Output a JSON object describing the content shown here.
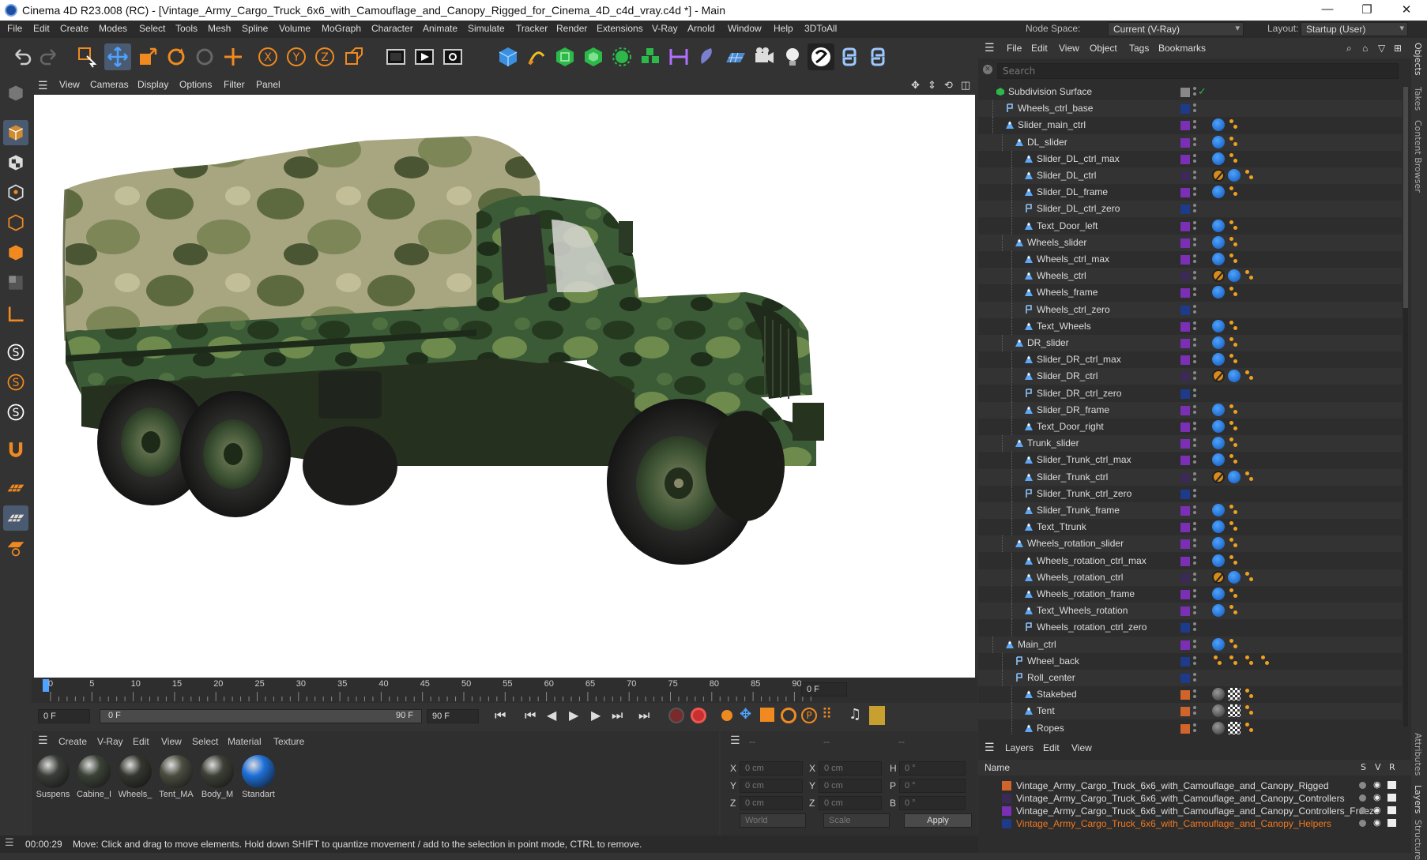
{
  "window": {
    "title": "Cinema 4D R23.008 (RC) - [Vintage_Army_Cargo_Truck_6x6_with_Camouflage_and_Canopy_Rigged_for_Cinema_4D_c4d_vray.c4d *] - Main",
    "minimize": "—",
    "restore": "❐",
    "close": "✕"
  },
  "menubar": {
    "items": [
      "File",
      "Edit",
      "Create",
      "Modes",
      "Select",
      "Tools",
      "Mesh",
      "Spline",
      "Volume",
      "MoGraph",
      "Character",
      "Animate",
      "Simulate",
      "Tracker",
      "Render",
      "Extensions",
      "V-Ray",
      "Arnold",
      "Window",
      "Help",
      "3DToAll"
    ],
    "node_space_label": "Node Space:",
    "node_space_value": "Current (V-Ray)",
    "layout_label": "Layout:",
    "layout_value": "Startup (User)"
  },
  "viewport_menu": [
    "View",
    "Cameras",
    "Display",
    "Options",
    "Filter",
    "Panel"
  ],
  "timeline": {
    "ticks": [
      "0",
      "5",
      "10",
      "15",
      "20",
      "25",
      "30",
      "35",
      "40",
      "45",
      "50",
      "55",
      "60",
      "65",
      "70",
      "75",
      "80",
      "85",
      "90"
    ],
    "current_frame_field": "0 F"
  },
  "transport": {
    "start_frame": "0 F",
    "preview_start": "0 F",
    "preview_end": "90 F",
    "end_frame": "90 F"
  },
  "material_menu": [
    "Create",
    "V-Ray",
    "Edit",
    "View",
    "Select",
    "Material",
    "Texture"
  ],
  "materials": [
    {
      "name": "Suspens",
      "color": "#3a3d38"
    },
    {
      "name": "Cabine_I",
      "color": "#3b4237"
    },
    {
      "name": "Wheels_",
      "color": "#34362f"
    },
    {
      "name": "Tent_MA",
      "color": "#4b4d40"
    },
    {
      "name": "Body_M",
      "color": "#3d4036"
    },
    {
      "name": "Standart",
      "color": "#1e6fd8"
    }
  ],
  "coords": {
    "header1": "--",
    "header2": "--",
    "header3": "--",
    "x_label": "X",
    "y_label": "Y",
    "z_label": "Z",
    "h_label": "H",
    "p_label": "P",
    "b_label": "B",
    "pos_x": "0 cm",
    "pos_y": "0 cm",
    "pos_z": "0 cm",
    "size_x": "0 cm",
    "size_y": "0 cm",
    "size_z": "0 cm",
    "rot_h": "0 °",
    "rot_p": "0 °",
    "rot_b": "0 °",
    "mode1": "World",
    "mode2": "Scale",
    "apply": "Apply"
  },
  "status": {
    "time": "00:00:29",
    "message": "Move: Click and drag to move elements. Hold down SHIFT to quantize movement / add to the selection in point mode, CTRL to remove."
  },
  "object_manager": {
    "menu": [
      "File",
      "Edit",
      "View",
      "Object",
      "Tags",
      "Bookmarks"
    ],
    "search_placeholder": "Search",
    "objects": [
      {
        "name": "Subdivision Surface",
        "indent": 0,
        "icon": "subdiv",
        "layer": "#555",
        "tags": []
      },
      {
        "name": "Wheels_ctrl_base",
        "indent": 1,
        "icon": "null",
        "layer": "#1e3a8a",
        "tags": []
      },
      {
        "name": "Slider_main_ctrl",
        "indent": 1,
        "icon": "bone",
        "layer": "#7a2fb5",
        "tags": [
          "blue",
          "ik"
        ]
      },
      {
        "name": "DL_slider",
        "indent": 2,
        "icon": "bone",
        "layer": "#7a2fb5",
        "tags": [
          "blue",
          "ik"
        ]
      },
      {
        "name": "Slider_DL_ctrl_max",
        "indent": 3,
        "icon": "bone",
        "layer": "#7a2fb5",
        "tags": [
          "blue",
          "ik"
        ]
      },
      {
        "name": "Slider_DL_ctrl",
        "indent": 3,
        "icon": "bone",
        "layer": "#3a2a55",
        "tags": [
          "off",
          "blue",
          "ik"
        ]
      },
      {
        "name": "Slider_DL_frame",
        "indent": 3,
        "icon": "bone",
        "layer": "#7a2fb5",
        "tags": [
          "blue",
          "ik"
        ]
      },
      {
        "name": "Slider_DL_ctrl_zero",
        "indent": 3,
        "icon": "null",
        "layer": "#1e3a8a",
        "tags": []
      },
      {
        "name": "Text_Door_left",
        "indent": 3,
        "icon": "bone",
        "layer": "#7a2fb5",
        "tags": [
          "blue",
          "ik"
        ]
      },
      {
        "name": "Wheels_slider",
        "indent": 2,
        "icon": "bone",
        "layer": "#7a2fb5",
        "tags": [
          "blue",
          "ik"
        ]
      },
      {
        "name": "Wheels_ctrl_max",
        "indent": 3,
        "icon": "bone",
        "layer": "#7a2fb5",
        "tags": [
          "blue",
          "ik"
        ]
      },
      {
        "name": "Wheels_ctrl",
        "indent": 3,
        "icon": "bone",
        "layer": "#3a2a55",
        "tags": [
          "off",
          "blue",
          "ik"
        ]
      },
      {
        "name": "Wheels_frame",
        "indent": 3,
        "icon": "bone",
        "layer": "#7a2fb5",
        "tags": [
          "blue",
          "ik"
        ]
      },
      {
        "name": "Wheels_ctrl_zero",
        "indent": 3,
        "icon": "null",
        "layer": "#1e3a8a",
        "tags": []
      },
      {
        "name": "Text_Wheels",
        "indent": 3,
        "icon": "bone",
        "layer": "#7a2fb5",
        "tags": [
          "blue",
          "ik"
        ]
      },
      {
        "name": "DR_slider",
        "indent": 2,
        "icon": "bone",
        "layer": "#7a2fb5",
        "tags": [
          "blue",
          "ik"
        ]
      },
      {
        "name": "Slider_DR_ctrl_max",
        "indent": 3,
        "icon": "bone",
        "layer": "#7a2fb5",
        "tags": [
          "blue",
          "ik"
        ]
      },
      {
        "name": "Slider_DR_ctrl",
        "indent": 3,
        "icon": "bone",
        "layer": "#3a2a55",
        "tags": [
          "off",
          "blue",
          "ik"
        ]
      },
      {
        "name": "Slider_DR_ctrl_zero",
        "indent": 3,
        "icon": "null",
        "layer": "#1e3a8a",
        "tags": []
      },
      {
        "name": "Slider_DR_frame",
        "indent": 3,
        "icon": "bone",
        "layer": "#7a2fb5",
        "tags": [
          "blue",
          "ik"
        ]
      },
      {
        "name": "Text_Door_right",
        "indent": 3,
        "icon": "bone",
        "layer": "#7a2fb5",
        "tags": [
          "blue",
          "ik"
        ]
      },
      {
        "name": "Trunk_slider",
        "indent": 2,
        "icon": "bone",
        "layer": "#7a2fb5",
        "tags": [
          "blue",
          "ik"
        ]
      },
      {
        "name": "Slider_Trunk_ctrl_max",
        "indent": 3,
        "icon": "bone",
        "layer": "#7a2fb5",
        "tags": [
          "blue",
          "ik"
        ]
      },
      {
        "name": "Slider_Trunk_ctrl",
        "indent": 3,
        "icon": "bone",
        "layer": "#3a2a55",
        "tags": [
          "off",
          "blue",
          "ik"
        ]
      },
      {
        "name": "Slider_Trunk_ctrl_zero",
        "indent": 3,
        "icon": "null",
        "layer": "#1e3a8a",
        "tags": []
      },
      {
        "name": "Slider_Trunk_frame",
        "indent": 3,
        "icon": "bone",
        "layer": "#7a2fb5",
        "tags": [
          "blue",
          "ik"
        ]
      },
      {
        "name": "Text_Ttrunk",
        "indent": 3,
        "icon": "bone",
        "layer": "#7a2fb5",
        "tags": [
          "blue",
          "ik"
        ]
      },
      {
        "name": "Wheels_rotation_slider",
        "indent": 2,
        "icon": "bone",
        "layer": "#7a2fb5",
        "tags": [
          "blue",
          "ik"
        ]
      },
      {
        "name": "Wheels_rotation_ctrl_max",
        "indent": 3,
        "icon": "bone",
        "layer": "#7a2fb5",
        "tags": [
          "blue",
          "ik"
        ]
      },
      {
        "name": "Wheels_rotation_ctrl",
        "indent": 3,
        "icon": "bone",
        "layer": "#3a2a55",
        "tags": [
          "off",
          "blue",
          "ik"
        ]
      },
      {
        "name": "Wheels_rotation_frame",
        "indent": 3,
        "icon": "bone",
        "layer": "#7a2fb5",
        "tags": [
          "blue",
          "ik"
        ]
      },
      {
        "name": "Text_Wheels_rotation",
        "indent": 3,
        "icon": "bone",
        "layer": "#7a2fb5",
        "tags": [
          "blue",
          "ik"
        ]
      },
      {
        "name": "Wheels_rotation_ctrl_zero",
        "indent": 3,
        "icon": "null",
        "layer": "#1e3a8a",
        "tags": []
      },
      {
        "name": "Main_ctrl",
        "indent": 1,
        "icon": "bone",
        "layer": "#7a2fb5",
        "tags": [
          "blue",
          "ik"
        ]
      },
      {
        "name": "Wheel_back",
        "indent": 2,
        "icon": "null",
        "layer": "#1e3a8a",
        "tags": [
          "ik",
          "ik",
          "ik",
          "ik"
        ]
      },
      {
        "name": "Roll_center",
        "indent": 2,
        "icon": "null",
        "layer": "#1e3a8a",
        "tags": []
      },
      {
        "name": "Stakebed",
        "indent": 3,
        "icon": "bone",
        "layer": "#d0642a",
        "tags": [
          "sph",
          "chk",
          "ik"
        ]
      },
      {
        "name": "Tent",
        "indent": 3,
        "icon": "bone",
        "layer": "#d0642a",
        "tags": [
          "sph",
          "chk",
          "ik"
        ]
      },
      {
        "name": "Ropes",
        "indent": 3,
        "icon": "bone",
        "layer": "#d0642a",
        "tags": [
          "sph",
          "chk",
          "ik"
        ]
      }
    ]
  },
  "layers": {
    "menu": [
      "Layers",
      "Edit",
      "View"
    ],
    "col_name": "Name",
    "col_s": "S",
    "col_v": "V",
    "col_r": "R",
    "items": [
      {
        "name": "Vintage_Army_Cargo_Truck_6x6_with_Camouflage_and_Canopy_Rigged",
        "color": "#d0642a",
        "text_color": "#dddddd"
      },
      {
        "name": "Vintage_Army_Cargo_Truck_6x6_with_Camouflage_and_Canopy_Controllers",
        "color": "#3a2a55",
        "text_color": "#dddddd"
      },
      {
        "name": "Vintage_Army_Cargo_Truck_6x6_with_Camouflage_and_Canopy_Controllers_Freeze",
        "color": "#7a2fb5",
        "text_color": "#dddddd"
      },
      {
        "name": "Vintage_Army_Cargo_Truck_6x6_with_Camouflage_and_Canopy_Helpers",
        "color": "#1e3a8a",
        "text_color": "#f07820"
      }
    ]
  },
  "right_strip": [
    "Objects",
    "Takes",
    "Content Browser",
    "Attributes",
    "Layers",
    "Structure"
  ]
}
